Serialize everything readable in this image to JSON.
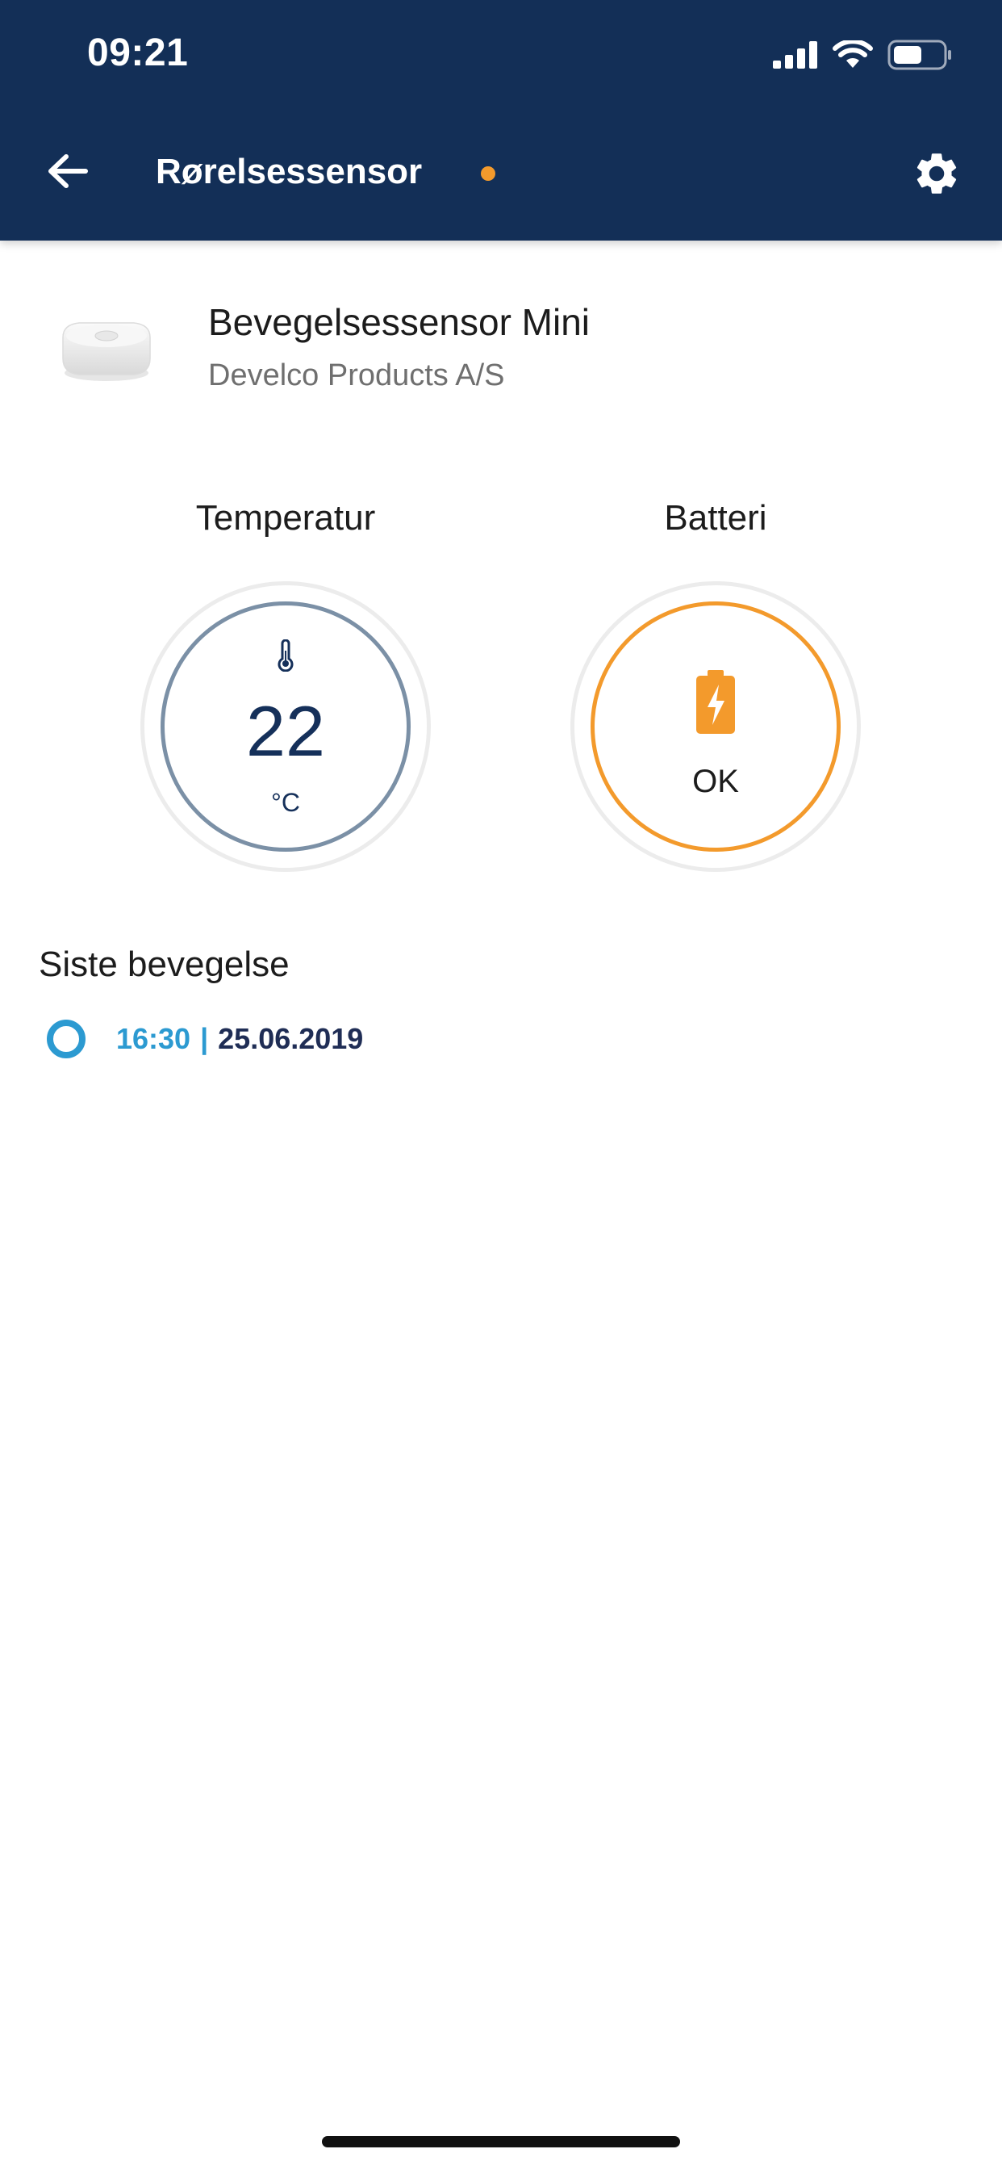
{
  "status_bar": {
    "time": "09:21",
    "icons": [
      "signal-icon",
      "wifi-icon",
      "battery-status-icon"
    ]
  },
  "header": {
    "title": "Rørelsessensor",
    "back_icon": "arrow-left-icon",
    "settings_icon": "gear-icon",
    "status_dot_color": "#f39a2c",
    "background_color": "#132f57"
  },
  "device": {
    "name": "Bevegelsessensor Mini",
    "manufacturer": "Develco Products A/S",
    "image": "motion-sensor-device-image"
  },
  "gauges": {
    "temperature": {
      "title": "Temperatur",
      "value": "22",
      "unit": "°C",
      "icon": "thermometer-icon",
      "ring_color": "#7b90a6"
    },
    "battery": {
      "title": "Batteri",
      "value": "OK",
      "icon": "battery-charging-icon",
      "ring_color": "#f39a2c"
    }
  },
  "last_movement": {
    "title": "Siste bevegelse",
    "time": "16:30",
    "separator": "|",
    "date": "25.06.2019",
    "dot_color": "#2c9ad1"
  }
}
